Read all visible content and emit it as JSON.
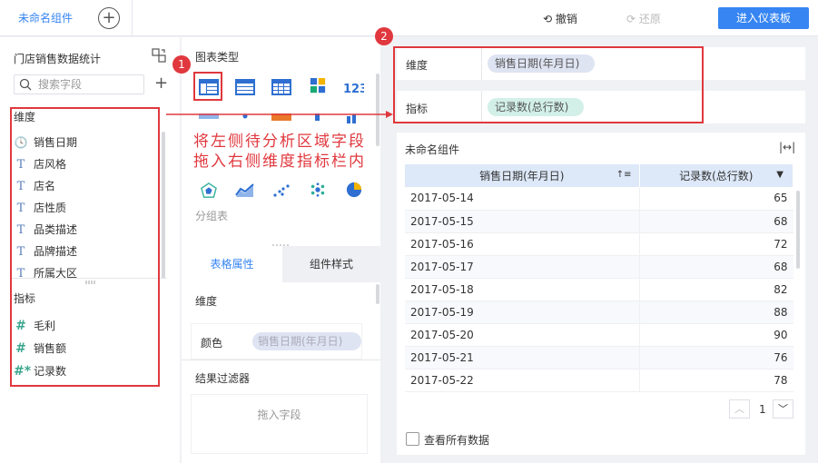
{
  "topbar": {
    "tab_label": "未命名组件",
    "add_tab": "+",
    "undo_label": "撤销",
    "redo_label": "还原",
    "enter_dashboard": "进入仪表板"
  },
  "left": {
    "dataset_title": "门店销售数据统计",
    "search_placeholder": "搜索字段",
    "dimension_header": "维度",
    "dimensions": [
      {
        "icon": "clock-icon",
        "label": "销售日期"
      },
      {
        "icon": "text-T-icon",
        "label": "店风格"
      },
      {
        "icon": "text-T-icon",
        "label": "店名"
      },
      {
        "icon": "text-T-icon",
        "label": "店性质"
      },
      {
        "icon": "text-T-icon",
        "label": "品类描述"
      },
      {
        "icon": "text-T-icon",
        "label": "品牌描述"
      },
      {
        "icon": "text-T-icon",
        "label": "所属大区"
      }
    ],
    "metric_header": "指标",
    "metrics": [
      {
        "icon": "hash-icon",
        "label": "毛利"
      },
      {
        "icon": "hash-icon",
        "label": "销售额"
      },
      {
        "icon": "hash-star-icon",
        "label": "记录数"
      }
    ]
  },
  "middle": {
    "chart_type_title": "图表类型",
    "annotation_line1": "将左侧待分析区域字段",
    "annotation_line2": "拖入右侧维度指标栏内",
    "group_table_label": "分组表",
    "prop_tab_active": "表格属性",
    "prop_tab_other": "组件样式",
    "dimension_label": "维度",
    "color_label": "颜色",
    "color_pill": "销售日期(年月日)",
    "filter_label": "结果过滤器",
    "drop_field": "拖入字段"
  },
  "right": {
    "dim_label": "维度",
    "dim_pill": "销售日期(年月日)",
    "metric_label": "指标",
    "metric_pill": "记录数(总行数)",
    "component_title": "未命名组件",
    "table": {
      "headers": [
        "销售日期(年月日)",
        "记录数(总行数)"
      ],
      "rows": [
        [
          "2017-05-14",
          "65"
        ],
        [
          "2017-05-15",
          "68"
        ],
        [
          "2017-05-16",
          "72"
        ],
        [
          "2017-05-17",
          "68"
        ],
        [
          "2017-05-18",
          "82"
        ],
        [
          "2017-05-19",
          "88"
        ],
        [
          "2017-05-20",
          "90"
        ],
        [
          "2017-05-21",
          "76"
        ],
        [
          "2017-05-22",
          "78"
        ]
      ]
    },
    "page_number": "1",
    "view_all_label": "查看所有数据"
  },
  "badges": [
    "1",
    "2"
  ],
  "colors": {
    "accent": "#3685f2",
    "annotation_red": "#e0383e"
  }
}
